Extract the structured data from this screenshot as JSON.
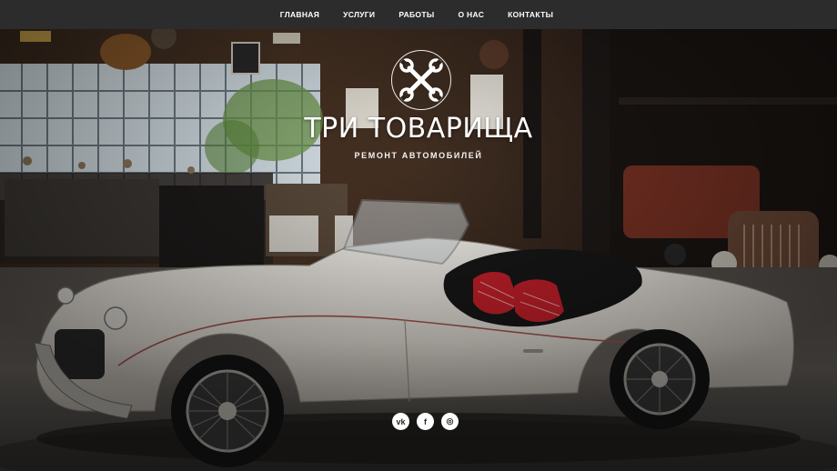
{
  "nav": {
    "items": [
      {
        "label": "ГЛАВНАЯ"
      },
      {
        "label": "УСЛУГИ"
      },
      {
        "label": "РАБОТЫ"
      },
      {
        "label": "О НАС"
      },
      {
        "label": "КОНТАКТЫ"
      }
    ]
  },
  "hero": {
    "title": "ТРИ ТОВАРИЩА",
    "subtitle": "РЕМОНТ АВТОМОБИЛЕЙ",
    "logo_icon": "crossed-wrenches-icon"
  },
  "socials": [
    {
      "name": "vk-icon",
      "glyph": "vk"
    },
    {
      "name": "facebook-icon",
      "glyph": "f"
    },
    {
      "name": "instagram-icon",
      "glyph": "◎"
    }
  ],
  "colors": {
    "nav_bg": "#2c2c2c",
    "nav_text": "#ffffff",
    "car_body": "#ece8e2",
    "seat_red": "#c8202a"
  }
}
